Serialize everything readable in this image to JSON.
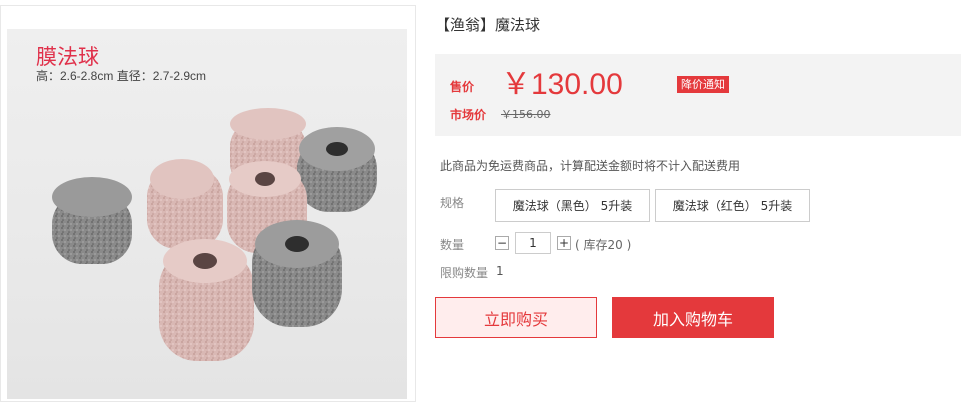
{
  "product": {
    "title": "【渔翁】魔法球",
    "image": {
      "overlay_title": "膜法球",
      "overlay_dims": "高：2.6-2.8cm  直径：2.7-2.9cm"
    }
  },
  "price": {
    "label": "售价",
    "value": "￥130.00",
    "notice_button": "降价通知",
    "market_label": "市场价",
    "market_value": "￥156.00"
  },
  "shipping_note": "此商品为免运费商品，计算配送金额时将不计入配送费用",
  "spec": {
    "label": "规格",
    "options": [
      "魔法球（黑色） 5升装",
      "魔法球（红色） 5升装"
    ]
  },
  "quantity": {
    "label": "数量",
    "minus": "−",
    "value": "1",
    "plus": "+",
    "stock": "( 库存20 )"
  },
  "limit": {
    "label": "限购数量",
    "value": "1"
  },
  "actions": {
    "buy_now": "立即购买",
    "add_to_cart": "加入购物车"
  },
  "colors": {
    "accent": "#e4393c",
    "price_bg": "#f3f3f3"
  }
}
